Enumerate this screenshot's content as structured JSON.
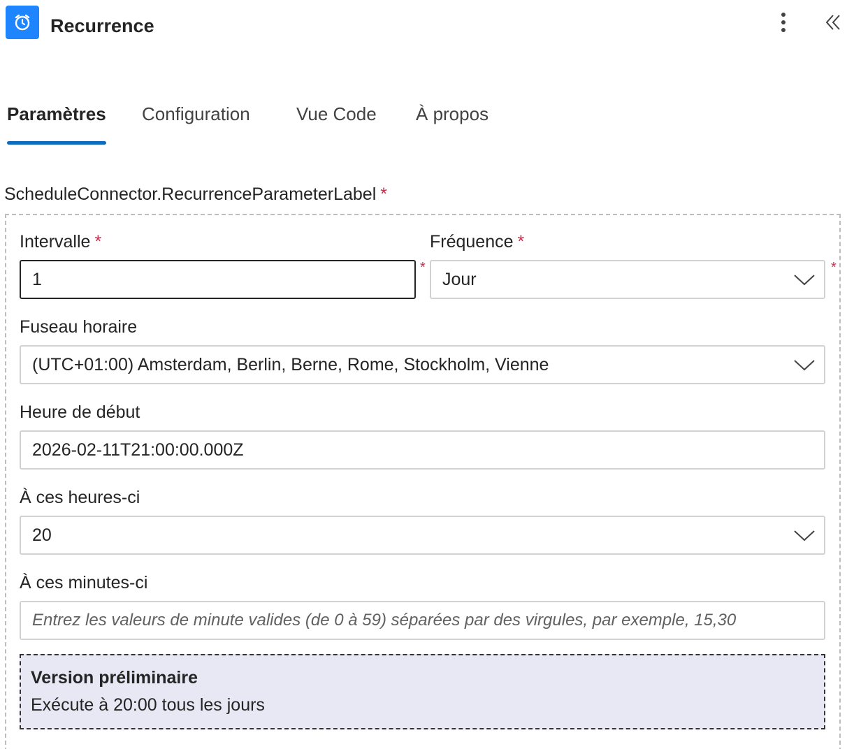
{
  "header": {
    "title": "Recurrence",
    "app_icon": "alarm-clock-icon",
    "brand_color": "#1f85ff"
  },
  "tabs": [
    {
      "label": "Paramètres",
      "active": true
    },
    {
      "label": "Configuration",
      "active": false
    },
    {
      "label": "Vue Code",
      "active": false
    },
    {
      "label": "À propos",
      "active": false
    }
  ],
  "section": {
    "label": "ScheduleConnector.RecurrenceParameterLabel",
    "required_mark": "*"
  },
  "fields": {
    "interval": {
      "label": "Intervalle",
      "value": "1",
      "required_mark": "*"
    },
    "frequency": {
      "label": "Fréquence",
      "value": "Jour",
      "required_mark": "*"
    },
    "timezone": {
      "label": "Fuseau horaire",
      "value": "(UTC+01:00) Amsterdam, Berlin, Berne, Rome, Stockholm, Vienne"
    },
    "start_time": {
      "label": "Heure de début",
      "value": "2026-02-11T21:00:00.000Z"
    },
    "hours": {
      "label": "À ces heures-ci",
      "value": "20"
    },
    "minutes": {
      "label": "À ces minutes-ci",
      "placeholder": "Entrez les valeurs de minute valides (de 0 à 59) séparées par des virgules, par exemple, 15,30"
    }
  },
  "preview": {
    "title": "Version préliminaire",
    "text": "Exécute à 20:00 tous les jours"
  },
  "colors": {
    "accent": "#0f6cbd",
    "required": "#c4314b",
    "preview_bg": "#e8e8f4"
  }
}
